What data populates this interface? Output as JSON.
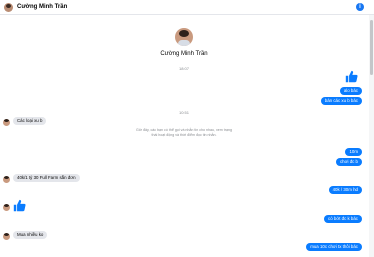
{
  "header": {
    "name": "Cường Minh Trần",
    "info_icon": "info-icon"
  },
  "profile": {
    "name": "Cường Minh Trần"
  },
  "timestamps": [
    "18:07",
    "10:51"
  ],
  "notice": "Giờ đây, các bạn có thể gọi và nhắn tin cho nhau, xem trạng thái hoạt động và thời điểm đọc tin nhắn.",
  "messages": {
    "out_1": "alo bác",
    "out_2": "bán các xu b bác",
    "in_1": "Các loại xu b",
    "out_3": "10m",
    "out_4": "chơi đc b",
    "in_2": "40k/1 tỷ 30 Full Farm sẵn đơn",
    "out_5": "40k / 30m hd",
    "out_6": "có bớt đc k bác",
    "in_3": "Mua nhiều ko",
    "out_7": "mua 10c chơi tx thôi bác"
  },
  "colors": {
    "accent": "#0a7cff",
    "incoming": "#e4e6eb"
  }
}
